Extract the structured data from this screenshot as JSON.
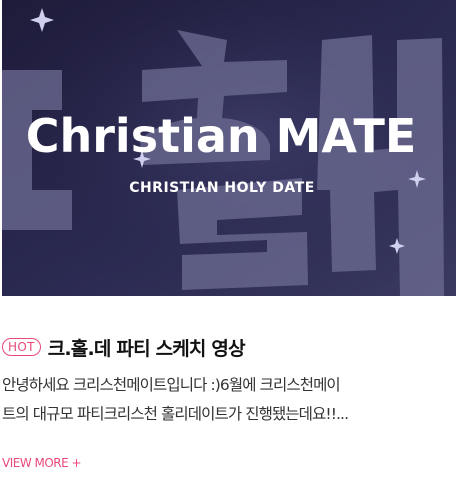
{
  "post": {
    "thumbnail": {
      "main_text": "Christian MATE",
      "sub_text": "CHRISTIAN HOLY DATE",
      "background_lettering": "크홀데",
      "background_color": "#2a2a4e"
    },
    "badge": "HOT",
    "title": "크.홀.데 파티 스케치 영상",
    "description_lines": [
      "안녕하세요 크리스천메이트입니다 :)6월에 크리스천메이",
      "트의 대규모 파티크리스천 홀리데이트가 진행됐는데요!!..."
    ],
    "view_more": "VIEW MORE +"
  },
  "colors": {
    "accent": "#e94a7a",
    "title": "#111111",
    "body_text": "#333333"
  }
}
